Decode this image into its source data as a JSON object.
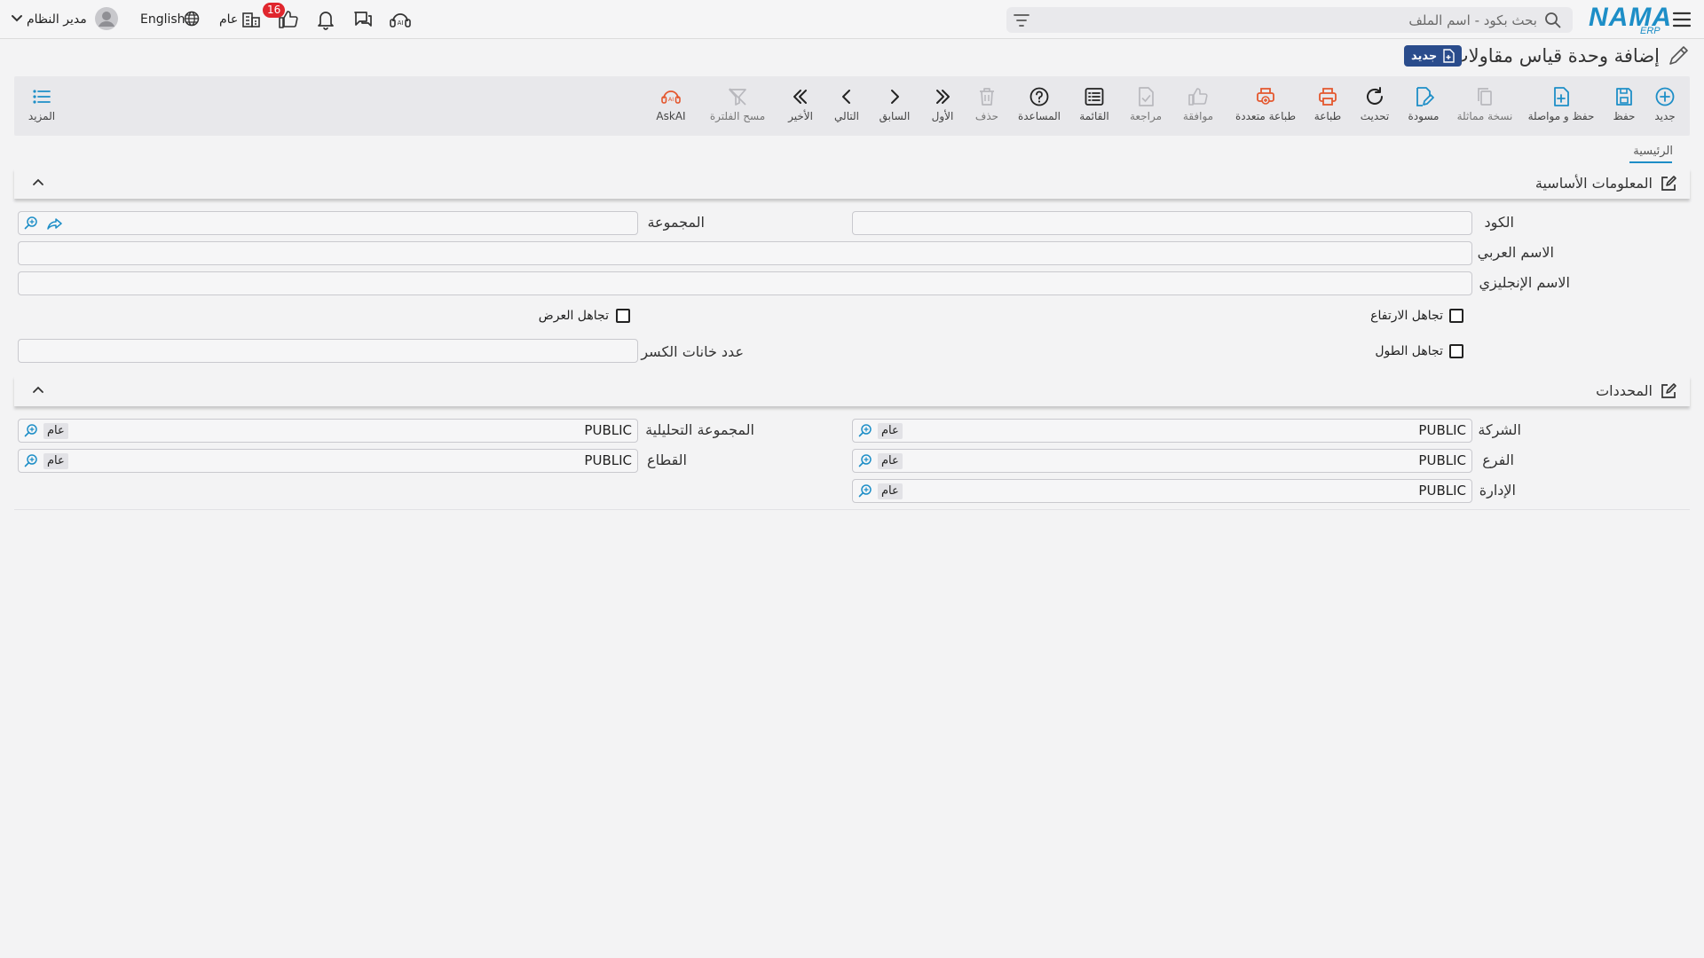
{
  "header": {
    "logo": "NAMA",
    "logo_sub": "ERP",
    "search_placeholder": "بحث بكود - اسم الملف",
    "language": "English",
    "public_label": "عام",
    "notification_count": "16",
    "user_name": "مدير النظام"
  },
  "page": {
    "title": "إضافة وحدة قياس مقاولات",
    "status_badge": "جديد"
  },
  "toolbar": {
    "new": "جديد",
    "save": "حفظ",
    "save_continue": "حفظ و مواصلة",
    "duplicate": "نسخة مماثلة",
    "draft": "مسودة",
    "refresh": "تحديث",
    "print": "طباعة",
    "multi_print": "طباعة متعددة",
    "approve": "موافقة",
    "review": "مراجعة",
    "list": "القائمة",
    "help": "المساعدة",
    "delete": "حذف",
    "first": "الأول",
    "previous": "السابق",
    "next": "التالي",
    "last": "الأخير",
    "clear_filter": "مسح الفلترة",
    "askai": "AskAI",
    "more": "المزيد"
  },
  "tabs": {
    "main": "الرئيسية"
  },
  "basic_info": {
    "title": "المعلومات الأساسية",
    "code_label": "الكود",
    "code_value": "",
    "group_label": "المجموعة",
    "group_value": "",
    "arabic_name_label": "الاسم العربي",
    "arabic_name_value": "",
    "english_name_label": "الاسم الإنجليزي",
    "english_name_value": "",
    "ignore_height_label": "تجاهل الارتفاع",
    "ignore_width_label": "تجاهل العرض",
    "ignore_length_label": "تجاهل الطول",
    "decimal_places_label": "عدد خانات الكسر",
    "decimal_places_value": ""
  },
  "determinants": {
    "title": "المحددات",
    "company_label": "الشركة",
    "company_value": "PUBLIC",
    "company_chip": "عام",
    "analytic_group_label": "المجموعة التحليلية",
    "analytic_group_value": "PUBLIC",
    "analytic_group_chip": "عام",
    "branch_label": "الفرع",
    "branch_value": "PUBLIC",
    "branch_chip": "عام",
    "sector_label": "القطاع",
    "sector_value": "PUBLIC",
    "sector_chip": "عام",
    "department_label": "الإدارة",
    "department_value": "PUBLIC",
    "department_chip": "عام"
  },
  "colors": {
    "accent": "#1d8ec7",
    "print": "#e4572e",
    "badge": "#e0262d",
    "new_badge": "#2a4c8c"
  }
}
